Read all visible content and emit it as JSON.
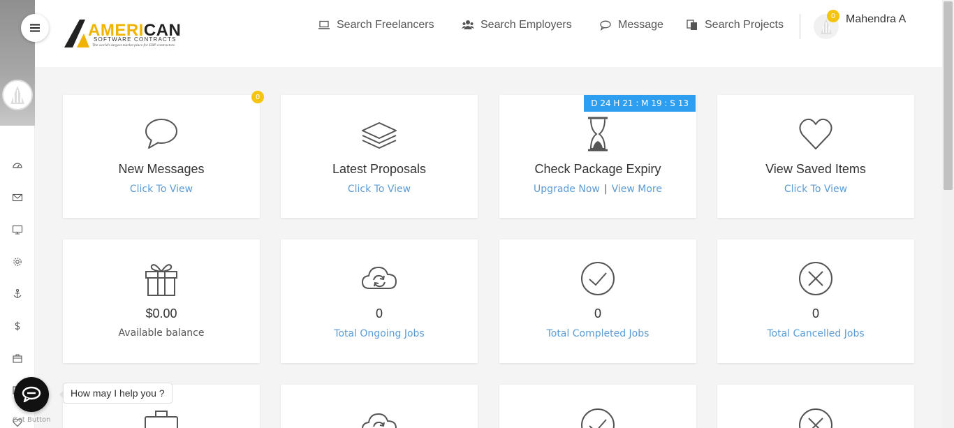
{
  "header": {
    "logo_brand_accent": "AMERI",
    "logo_brand_rest": "CAN",
    "logo_subtitle": "SOFTWARE CONTRACTS",
    "logo_tagline": "The world's largest market place for ERP contractors",
    "nav": [
      {
        "label": "Search Freelancers",
        "icon": "laptop-icon"
      },
      {
        "label": "Search Employers",
        "icon": "users-icon"
      },
      {
        "label": "Message",
        "icon": "chat-icon"
      },
      {
        "label": "Search Projects",
        "icon": "documents-icon"
      }
    ],
    "user_name": "Mahendra A",
    "user_badge": "0"
  },
  "sidebar": {
    "icons": [
      "dashboard-icon",
      "envelope-icon",
      "monitor-icon",
      "gear-icon",
      "anchor-icon",
      "dollar-icon",
      "briefcase-icon",
      "folder-icon",
      "heart-icon"
    ]
  },
  "cards_row1": [
    {
      "title": "New Messages",
      "link": "Click To View",
      "icon": "speech-bubble-icon",
      "badge": "0"
    },
    {
      "title": "Latest Proposals",
      "link": "Click To View",
      "icon": "layers-icon"
    },
    {
      "title": "Check Package Expiry",
      "link_a": "Upgrade Now",
      "separator": "|",
      "link_b": "View More",
      "icon": "hourglass-icon",
      "timer": "D 24    H 21 : M 19 : S 13"
    },
    {
      "title": "View Saved Items",
      "link": "Click To View",
      "icon": "heart-outline-icon"
    }
  ],
  "cards_row2": [
    {
      "value": "$0.00",
      "label": "Available balance",
      "icon": "gift-icon"
    },
    {
      "value": "0",
      "label": "Total Ongoing Jobs",
      "icon": "cloud-sync-icon"
    },
    {
      "value": "0",
      "label": "Total Completed Jobs",
      "icon": "check-circle-icon"
    },
    {
      "value": "0",
      "label": "Total Cancelled Jobs",
      "icon": "x-circle-icon"
    }
  ],
  "chat": {
    "tooltip": "How may I help you ?",
    "label": "Get Button"
  },
  "colors": {
    "accent_blue": "#5b9bd5",
    "badge_yellow": "#f5c40f",
    "timer_blue": "#2e9ff0"
  }
}
